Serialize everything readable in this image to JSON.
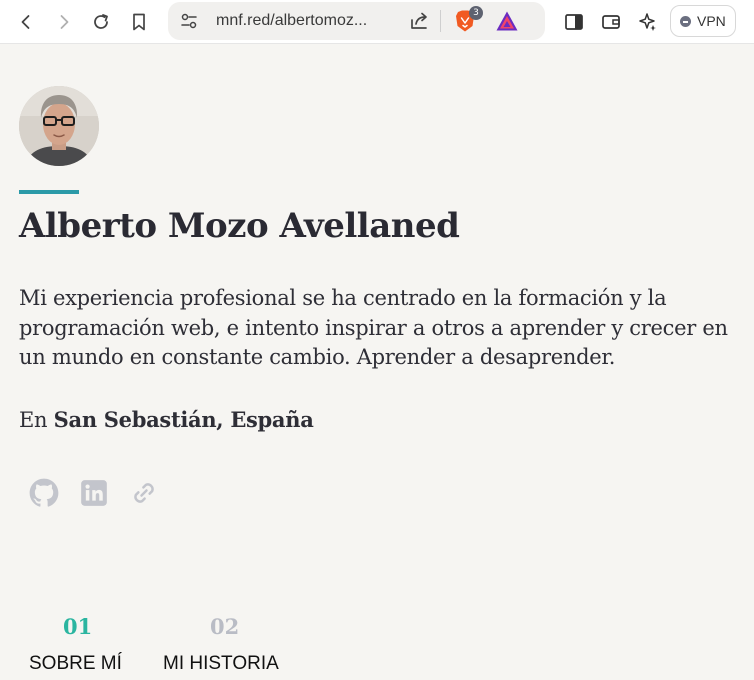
{
  "browser": {
    "url": "mnf.red/albertomoz...",
    "brave_badge_count": "3",
    "vpn_label": "VPN"
  },
  "profile": {
    "name": "Alberto Mozo Avellaned",
    "bio": "Mi experiencia profesional se ha centrado en la formación y la programación web, e intento inspirar a otros a aprender y crecer en un mundo en constante cambio. Aprender a desaprender.",
    "location_prefix": "En",
    "location": "San Sebastián, España"
  },
  "social_icons": [
    "github-icon",
    "linkedin-icon",
    "link-icon"
  ],
  "tabs": [
    {
      "number": "01",
      "label": "SOBRE MÍ",
      "color": "#2bb5a0"
    },
    {
      "number": "02",
      "label": "MI HISTORIA",
      "color": "#b9bcc5"
    }
  ],
  "colors": {
    "accent": "#2b9aa8",
    "active_tab": "#2bb5a0",
    "inactive_tab": "#b9bcc5",
    "background": "#f6f5f2",
    "icon_gray": "#c3c5cc"
  }
}
